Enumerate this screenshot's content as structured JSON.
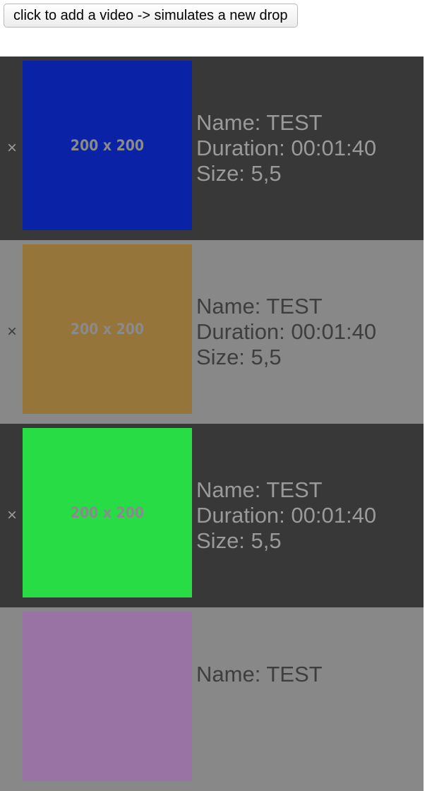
{
  "toolbar": {
    "add_label": "click to add a video -> simulates a new drop"
  },
  "videos": [
    {
      "remove_glyph": "×",
      "thumb_color": "#0a23a6",
      "thumb_label": "200 x 200",
      "name": "Name: TEST",
      "duration": "Duration: 00:01:40",
      "size": "Size: 5,5"
    },
    {
      "remove_glyph": "×",
      "thumb_color": "#95753a",
      "thumb_label": "200 x 200",
      "name": "Name: TEST",
      "duration": "Duration: 00:01:40",
      "size": "Size: 5,5"
    },
    {
      "remove_glyph": "×",
      "thumb_color": "#27dc45",
      "thumb_label": "200 x 200",
      "name": "Name: TEST",
      "duration": "Duration: 00:01:40",
      "size": "Size: 5,5"
    },
    {
      "thumb_color": "#9a73a5",
      "name": "Name: TEST"
    }
  ],
  "colors": {
    "row_dark": "#383838",
    "row_light": "#888888"
  },
  "icons": {
    "remove": "close-icon"
  }
}
